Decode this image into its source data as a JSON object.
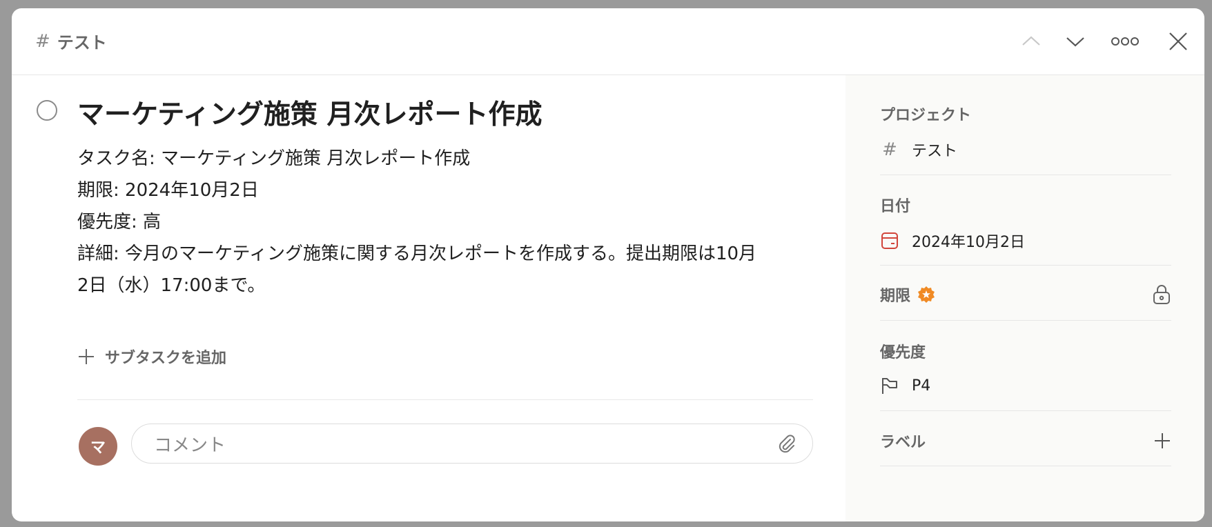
{
  "header": {
    "project_hash": "#",
    "project_name": "テスト"
  },
  "task": {
    "title": "マーケティング施策 月次レポート作成",
    "description_lines": [
      "タスク名: マーケティング施策 月次レポート作成",
      "期限: 2024年10月2日",
      "優先度: 高",
      "詳細: 今月のマーケティング施策に関する月次レポートを作成する。提出期限は10月",
      "2日（水）17:00まで。"
    ],
    "add_subtask_label": "サブタスクを追加"
  },
  "comment": {
    "avatar_initial": "マ",
    "placeholder": "コメント"
  },
  "sidebar": {
    "project": {
      "label": "プロジェクト",
      "hash": "#",
      "value": "テスト"
    },
    "date": {
      "label": "日付",
      "value": "2024年10月2日"
    },
    "deadline": {
      "label": "期限"
    },
    "priority": {
      "label": "優先度",
      "value": "P4"
    },
    "labels": {
      "label": "ラベル"
    }
  },
  "colors": {
    "accent_red": "#d1453b",
    "badge_orange": "#f08a24",
    "avatar": "#a77061"
  },
  "icons": [
    "chevron-up-icon",
    "chevron-down-icon",
    "more-icon",
    "close-icon",
    "plus-icon",
    "paperclip-icon",
    "calendar-icon",
    "star-badge-icon",
    "lock-icon",
    "flag-icon"
  ]
}
